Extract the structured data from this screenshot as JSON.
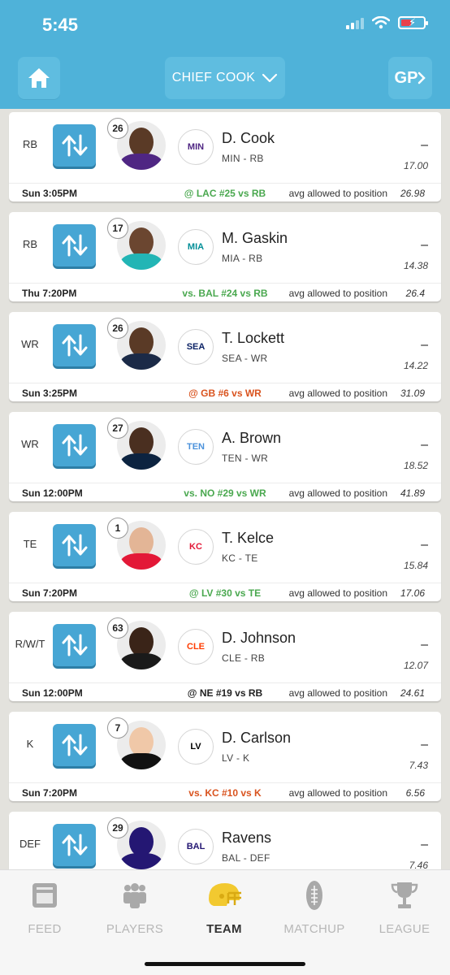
{
  "status_bar": {
    "time": "5:45"
  },
  "header": {
    "team_name": "CHIEF COOK",
    "gp_label": "GP"
  },
  "colors": {
    "header_bg": "#4fb2d9",
    "swap_button": "#47a6d4",
    "favorable": "#4aa84f",
    "unfavorable": "#d9531e",
    "neutral": "#222222"
  },
  "roster": [
    {
      "pos": "RB",
      "rank": "26",
      "name": "D. Cook",
      "team_pos": "MIN - RB",
      "proj": "–",
      "pts": "17.00",
      "game": "Sun 3:05PM",
      "opp": "@ LAC #25 vs RB",
      "opp_color": "green",
      "avg_label": "avg allowed to position",
      "avg": "26.98",
      "logo": "vikings-logo",
      "logo_text": "MIN",
      "logo_color": "#4f2683",
      "skin": "#5a3a26",
      "jersey": "#4f2683"
    },
    {
      "pos": "RB",
      "rank": "17",
      "name": "M. Gaskin",
      "team_pos": "MIA - RB",
      "proj": "–",
      "pts": "14.38",
      "game": "Thu 7:20PM",
      "opp": "vs. BAL #24 vs RB",
      "opp_color": "green",
      "avg_label": "avg allowed to position",
      "avg": "26.4",
      "logo": "dolphins-logo",
      "logo_text": "MIA",
      "logo_color": "#008e97",
      "skin": "#6b4630",
      "jersey": "#22b5b5"
    },
    {
      "pos": "WR",
      "rank": "26",
      "name": "T. Lockett",
      "team_pos": "SEA - WR",
      "proj": "–",
      "pts": "14.22",
      "game": "Sun 3:25PM",
      "opp": "@ GB #6 vs WR",
      "opp_color": "red",
      "avg_label": "avg allowed to position",
      "avg": "31.09",
      "logo": "seahawks-logo",
      "logo_text": "SEA",
      "logo_color": "#0b2265",
      "skin": "#5a3a26",
      "jersey": "#1b2a47"
    },
    {
      "pos": "WR",
      "rank": "27",
      "name": "A. Brown",
      "team_pos": "TEN - WR",
      "proj": "–",
      "pts": "18.52",
      "game": "Sun 12:00PM",
      "opp": "vs. NO #29 vs WR",
      "opp_color": "green",
      "avg_label": "avg allowed to position",
      "avg": "41.89",
      "logo": "titans-logo",
      "logo_text": "TEN",
      "logo_color": "#4b92db",
      "skin": "#4a2f20",
      "jersey": "#0c2340"
    },
    {
      "pos": "TE",
      "rank": "1",
      "name": "T. Kelce",
      "team_pos": "KC - TE",
      "proj": "–",
      "pts": "15.84",
      "game": "Sun 7:20PM",
      "opp": "@ LV #30 vs TE",
      "opp_color": "green",
      "avg_label": "avg allowed to position",
      "avg": "17.06",
      "logo": "chiefs-logo",
      "logo_text": "KC",
      "logo_color": "#e31837",
      "skin": "#e3b596",
      "jersey": "#e31837"
    },
    {
      "pos": "R/W/T",
      "rank": "63",
      "name": "D. Johnson",
      "team_pos": "CLE - RB",
      "proj": "–",
      "pts": "12.07",
      "game": "Sun 12:00PM",
      "opp": "@ NE #19 vs RB",
      "opp_color": "black",
      "avg_label": "avg allowed to position",
      "avg": "24.61",
      "logo": "browns-logo",
      "logo_text": "CLE",
      "logo_color": "#ff3c00",
      "skin": "#3a2418",
      "jersey": "#1a1a1a"
    },
    {
      "pos": "K",
      "rank": "7",
      "name": "D. Carlson",
      "team_pos": "LV - K",
      "proj": "–",
      "pts": "7.43",
      "game": "Sun 7:20PM",
      "opp": "vs. KC #10 vs K",
      "opp_color": "red",
      "avg_label": "avg allowed to position",
      "avg": "6.56",
      "logo": "raiders-logo",
      "logo_text": "LV",
      "logo_color": "#000000",
      "skin": "#f0c8a8",
      "jersey": "#111111"
    },
    {
      "pos": "DEF",
      "rank": "29",
      "name": "Ravens",
      "team_pos": "BAL - DEF",
      "proj": "–",
      "pts": "7.46",
      "game": "",
      "opp": "",
      "opp_color": "green",
      "avg_label": "",
      "avg": "",
      "logo": "ravens-logo",
      "logo_text": "BAL",
      "logo_color": "#241773",
      "skin": "#241773",
      "jersey": "#241773"
    }
  ],
  "tabs": [
    {
      "label": "FEED",
      "icon": "feed-icon",
      "active": false
    },
    {
      "label": "PLAYERS",
      "icon": "players-icon",
      "active": false
    },
    {
      "label": "TEAM",
      "icon": "helmet-icon",
      "active": true
    },
    {
      "label": "MATCHUP",
      "icon": "football-icon",
      "active": false
    },
    {
      "label": "LEAGUE",
      "icon": "trophy-icon",
      "active": false
    }
  ]
}
